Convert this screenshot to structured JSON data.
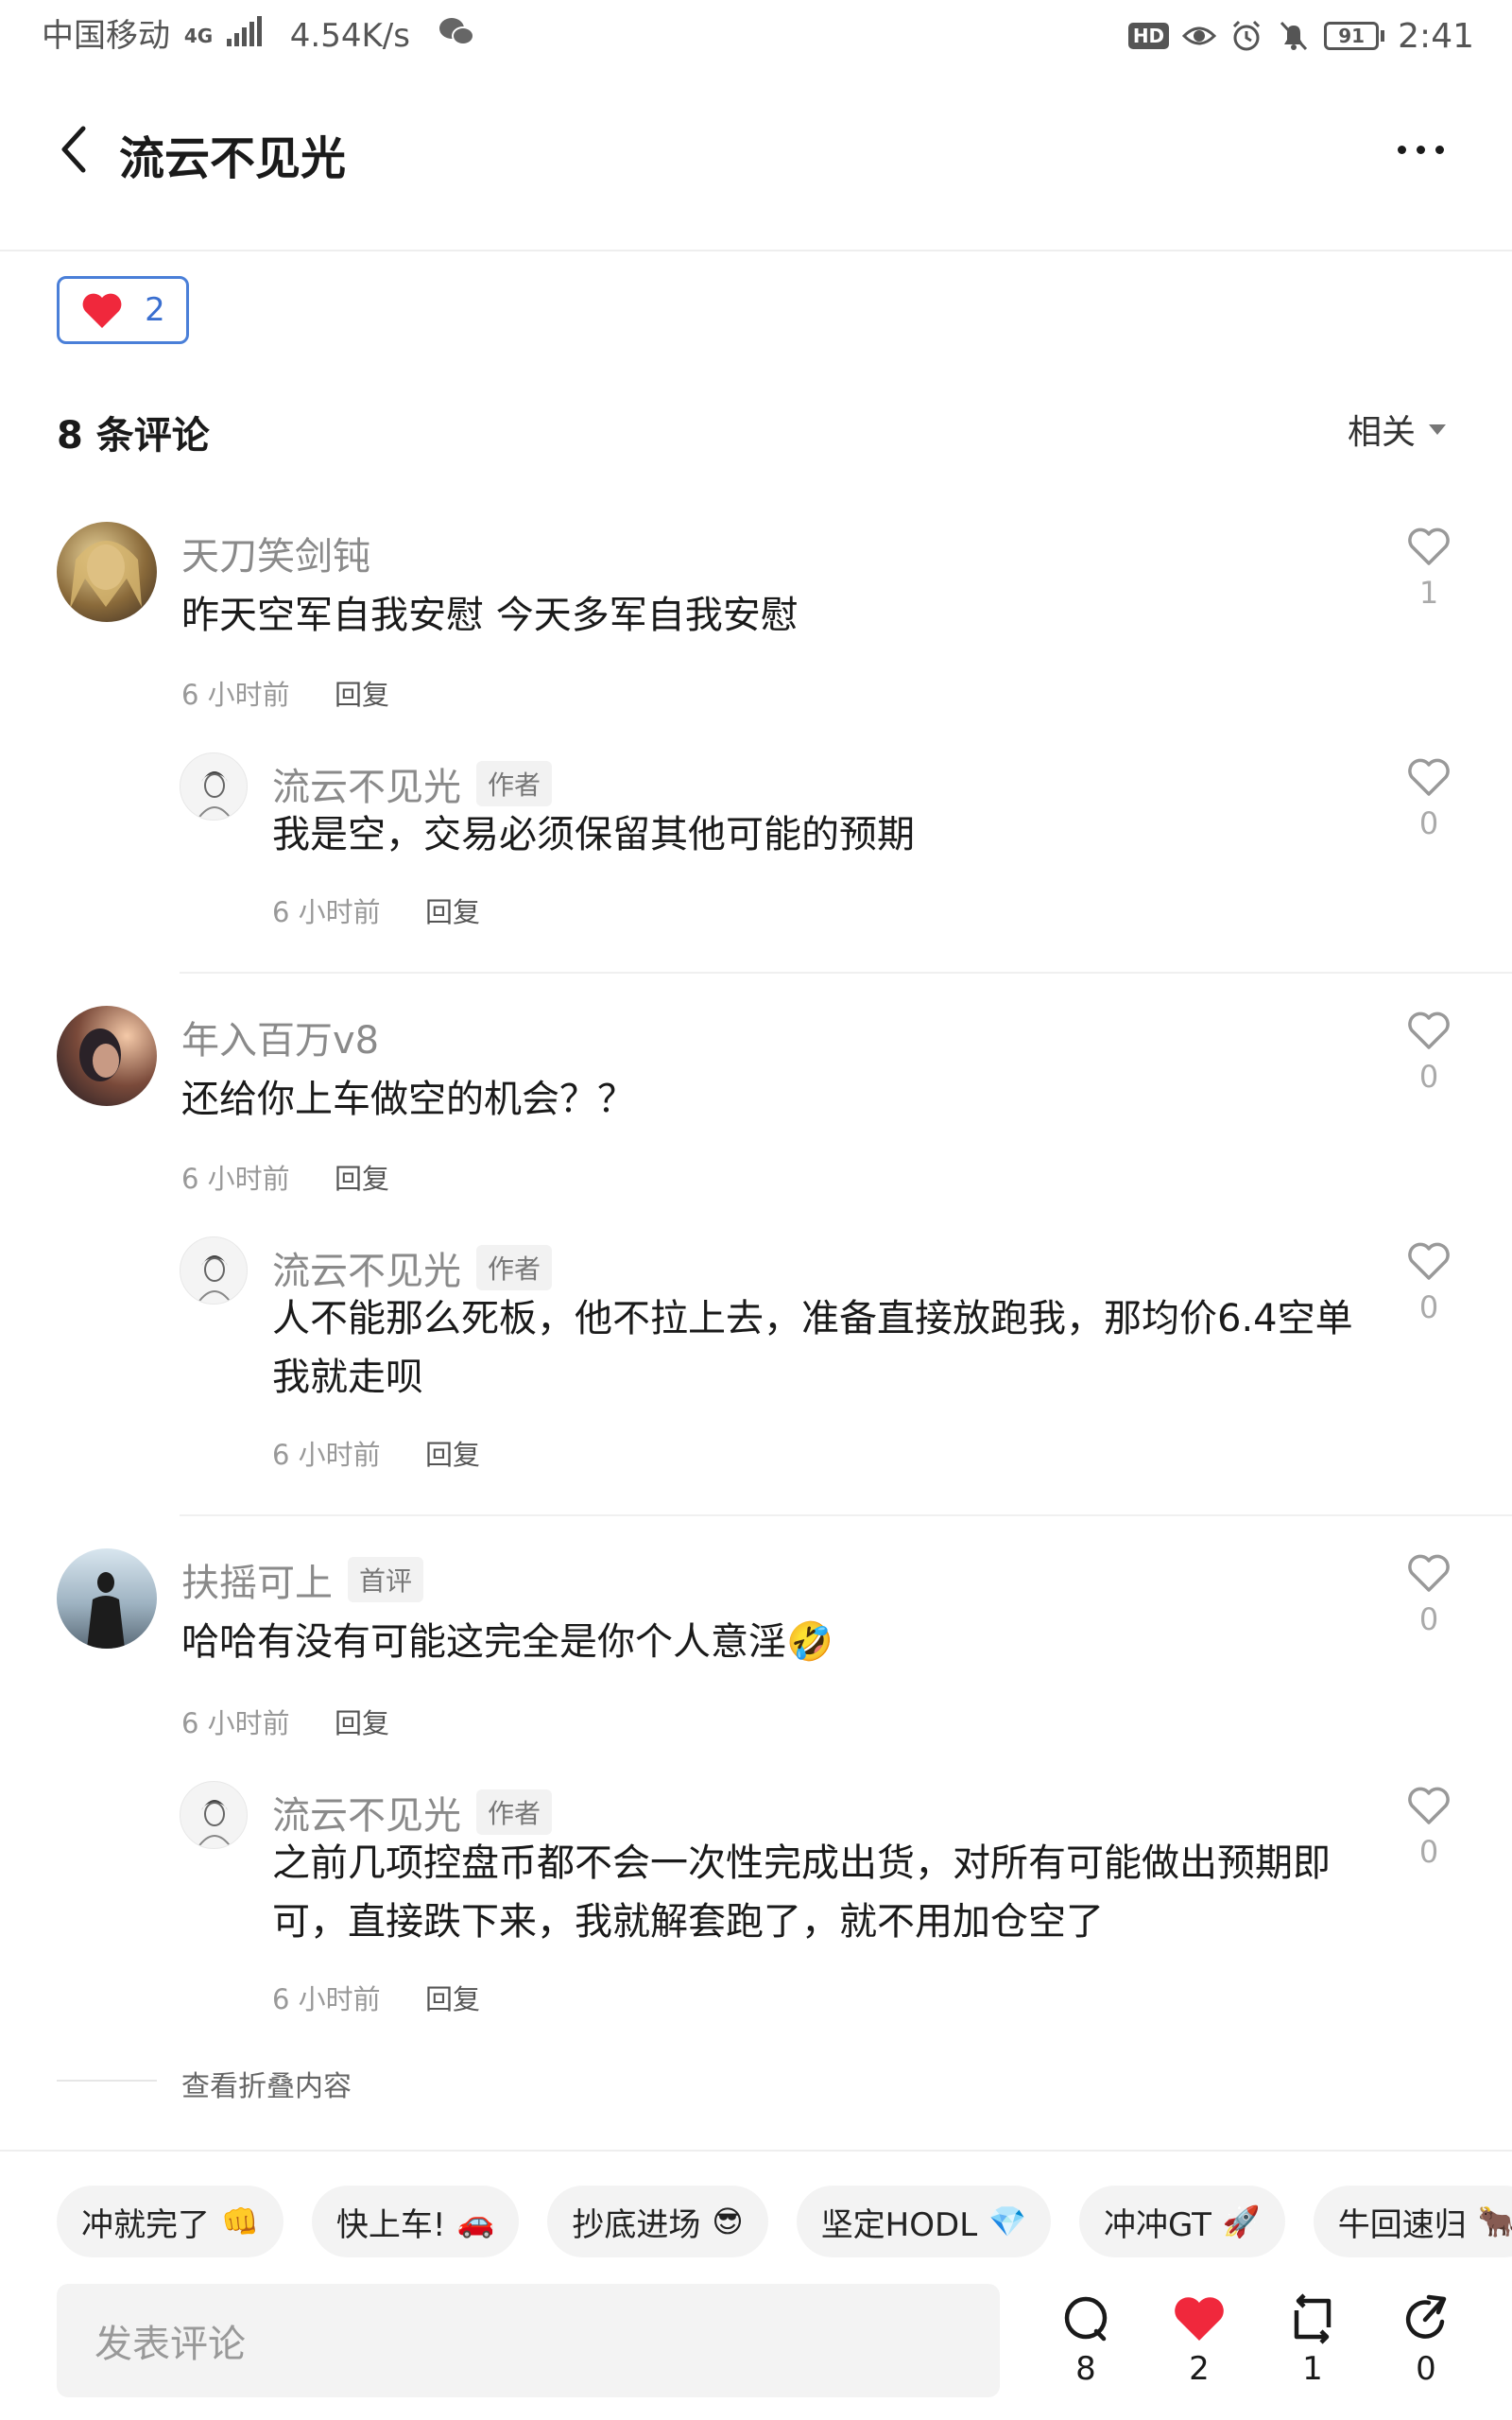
{
  "status_bar": {
    "carrier": "中国移动",
    "network": "4G",
    "speed": "4.54K/s",
    "hd": "HD",
    "battery": "91",
    "time": "2:41"
  },
  "header": {
    "title": "流云不见光",
    "more_label": "···"
  },
  "like_chip": {
    "count": "2"
  },
  "comments_header": {
    "count_label": "8 条评论",
    "sort_label": "相关"
  },
  "threads": [
    {
      "comment": {
        "user": "天刀笑剑钝",
        "text": "昨天空军自我安慰 今天多军自我安慰",
        "time": "6 小时前",
        "reply_label": "回复",
        "likes": "1"
      },
      "reply": {
        "user": "流云不见光",
        "tag": "作者",
        "text": "我是空，交易必须保留其他可能的预期",
        "time": "6 小时前",
        "reply_label": "回复",
        "likes": "0"
      }
    },
    {
      "comment": {
        "user": "年入百万v8",
        "text": "还给你上车做空的机会？？",
        "time": "6 小时前",
        "reply_label": "回复",
        "likes": "0"
      },
      "reply": {
        "user": "流云不见光",
        "tag": "作者",
        "text": "人不能那么死板，他不拉上去，准备直接放跑我，那均价6.4空单我就走呗",
        "time": "6 小时前",
        "reply_label": "回复",
        "likes": "0"
      }
    },
    {
      "comment": {
        "user": "扶摇可上",
        "tag": "首评",
        "text": "哈哈有没有可能这完全是你个人意淫🤣",
        "time": "6 小时前",
        "reply_label": "回复",
        "likes": "0"
      },
      "reply": {
        "user": "流云不见光",
        "tag": "作者",
        "text": "之前几项控盘币都不会一次性完成出货，对所有可能做出预期即可，直接跌下来，我就解套跑了，就不用加仓空了",
        "time": "6 小时前",
        "reply_label": "回复",
        "likes": "0"
      }
    }
  ],
  "folded_label": "查看折叠内容",
  "quick_chips": [
    {
      "text": "冲就完了",
      "emoji": "👊"
    },
    {
      "text": "快上车!",
      "emoji": "🚗"
    },
    {
      "text": "抄底进场",
      "emoji": "😎"
    },
    {
      "text": "坚定HODL",
      "emoji": "💎"
    },
    {
      "text": "冲冲GT",
      "emoji": "🚀"
    },
    {
      "text": "牛回速归",
      "emoji": "🐂"
    }
  ],
  "bottom_bar": {
    "input_placeholder": "发表评论",
    "comments_count": "8",
    "likes_count": "2",
    "reposts_count": "1",
    "shares_count": "0"
  },
  "colors": {
    "accent_blue": "#4a7fd8",
    "heart_red": "#f0283c"
  }
}
